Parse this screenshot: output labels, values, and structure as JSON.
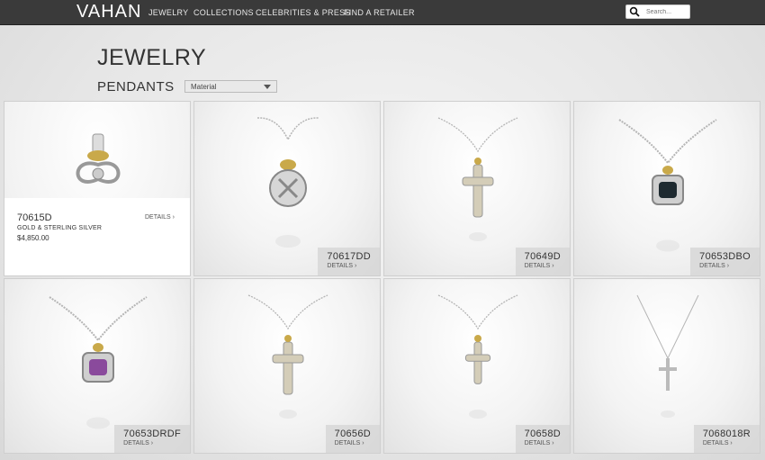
{
  "brand": "VAHAN",
  "nav": [
    "JEWELRY",
    "COLLECTIONS",
    "CELEBRITIES & PRESS",
    "FIND A RETAILER"
  ],
  "search": {
    "placeholder": "Search..."
  },
  "page_title": "JEWELRY",
  "section_title": "PENDANTS",
  "filter": {
    "label": "Material"
  },
  "details_label": "DETAILS ›",
  "products": [
    {
      "code": "70615D",
      "material": "GOLD & STERLING SILVER",
      "price": "$4,850.00",
      "style": "knot-pendant",
      "expanded": true
    },
    {
      "code": "70617DD",
      "style": "round-pendant"
    },
    {
      "code": "70649D",
      "style": "cross-pendant"
    },
    {
      "code": "70653DBO",
      "style": "onyx-pendant"
    },
    {
      "code": "70653DRDF",
      "style": "amethyst-pendant"
    },
    {
      "code": "70656D",
      "style": "cross-pendant"
    },
    {
      "code": "70658D",
      "style": "small-cross-pendant"
    },
    {
      "code": "7068018R",
      "style": "thin-cross-pendant"
    }
  ],
  "colors": {
    "topbar": "#3a3a3a",
    "silver": "#b5b5b5",
    "gold": "#c9a94a",
    "onyx": "#1e2a30",
    "amethyst": "#8a4a9c"
  }
}
